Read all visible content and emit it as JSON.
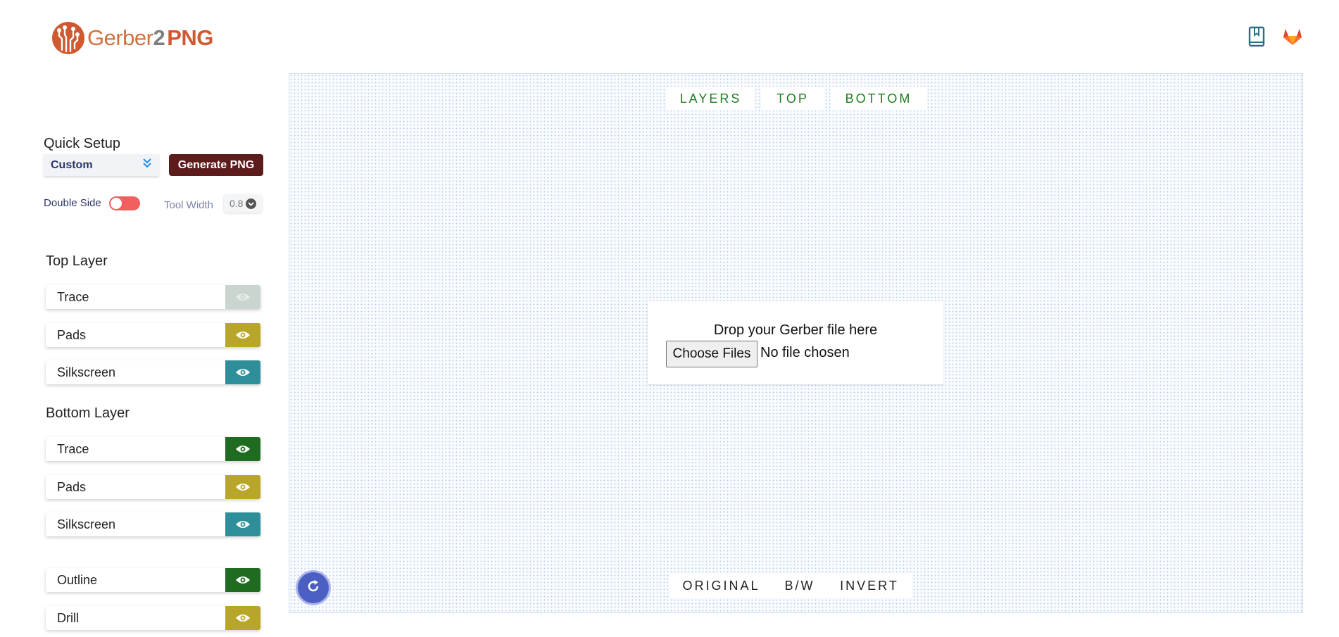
{
  "header": {
    "logo_part1": "Gerber",
    "logo_part2": "2",
    "logo_part3": "PNG",
    "icons": [
      "docs-bookmark-icon",
      "gitlab-icon"
    ]
  },
  "sidebar": {
    "quick_setup_title": "Quick Setup",
    "preset_selected": "Custom",
    "generate_button": "Generate PNG",
    "double_side_label": "Double Side",
    "double_side_on": false,
    "tool_width_label": "Tool Width",
    "tool_width_value": "0.8",
    "top_layer_title": "Top Layer",
    "top_layers": [
      {
        "label": "Trace",
        "color": "#c9d5ce"
      },
      {
        "label": "Pads",
        "color": "#b8a62b"
      },
      {
        "label": "Silkscreen",
        "color": "#2e8f9a"
      }
    ],
    "bottom_layer_title": "Bottom Layer",
    "bottom_layers": [
      {
        "label": "Trace",
        "color": "#1f6b1f"
      },
      {
        "label": "Pads",
        "color": "#b8a62b"
      },
      {
        "label": "Silkscreen",
        "color": "#2e8f9a"
      }
    ],
    "other_layers": [
      {
        "label": "Outline",
        "color": "#1f6b1f"
      },
      {
        "label": "Drill",
        "color": "#b8a62b"
      }
    ]
  },
  "main": {
    "view_tabs": [
      "LAYERS",
      "TOP",
      "BOTTOM"
    ],
    "drop_text": "Drop your Gerber file here",
    "file_button": "Choose Files",
    "file_status": "No file chosen",
    "color_tabs": [
      "ORIGINAL",
      "B/W",
      "INVERT"
    ]
  },
  "colors": {
    "brand": "#d0592f",
    "generate": "#5c1c1c",
    "tab_green": "#1f7d1f",
    "refresh": "#4a5fc1"
  }
}
